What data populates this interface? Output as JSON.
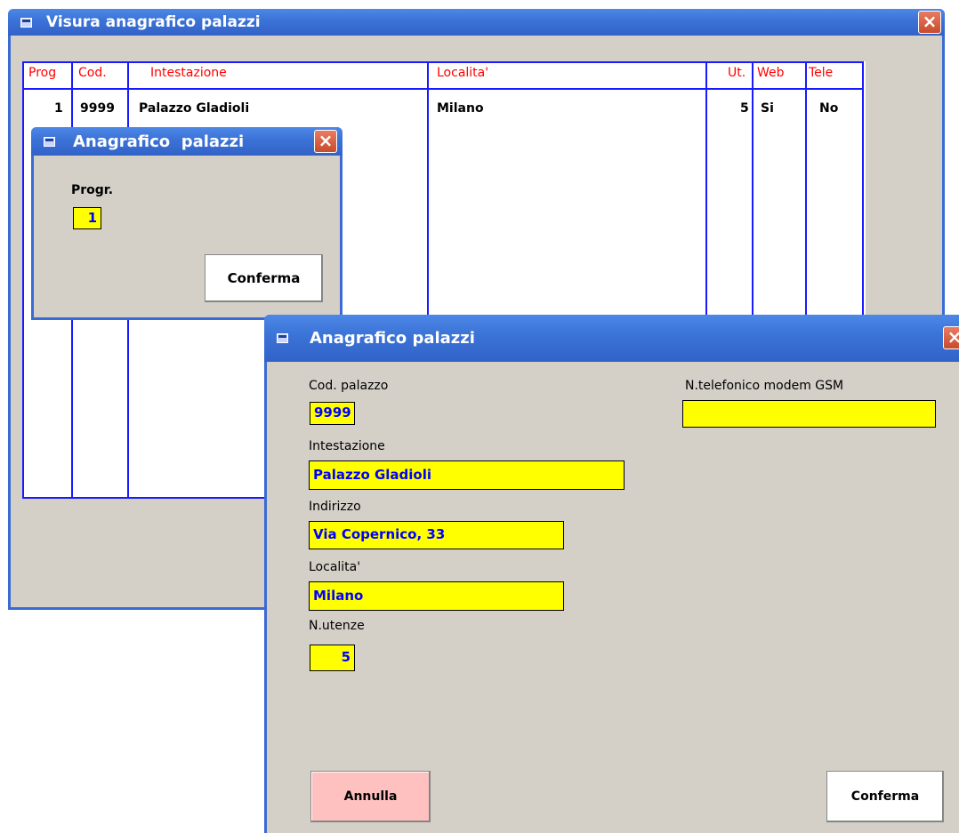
{
  "visura": {
    "title": "Visura anagrafico palazzi",
    "close_glyph": "×",
    "columns": [
      "Prog",
      "Cod.",
      "Intestazione",
      "Localita'",
      "Ut.",
      "Web",
      "Tele"
    ],
    "rows": [
      {
        "prog": "1",
        "cod": "9999",
        "intestazione": "Palazzo Gladioli",
        "localita": "Milano",
        "ut": "5",
        "web": "Si",
        "tele": "No"
      }
    ]
  },
  "small_dialog": {
    "title": "Anagrafico  palazzi",
    "close_glyph": "×",
    "progr_label": "Progr.",
    "progr_value": "1",
    "confirm_label": "Conferma"
  },
  "main_dialog": {
    "title": "Anagrafico palazzi",
    "close_glyph": "×",
    "cod_label": "Cod. palazzo",
    "cod_value": "9999",
    "intestazione_label": "Intestazione",
    "intestazione_value": "Palazzo Gladioli",
    "indirizzo_label": "Indirizzo",
    "indirizzo_value": "Via Copernico, 33",
    "localita_label": "Localita'",
    "localita_value": "Milano",
    "utenze_label": "N.utenze",
    "utenze_value": "5",
    "gsm_label": "N.telefonico modem GSM",
    "gsm_value": "",
    "cancel_label": "Annulla",
    "confirm_label": "Conferma"
  },
  "colors": {
    "field_bg": "#ffff00",
    "field_text": "#0000ff",
    "grid_lines": "#1a1aff",
    "header_text": "#ff0000",
    "cancel_bg": "#ffc0c0",
    "window_bg": "#d4d0c8"
  }
}
